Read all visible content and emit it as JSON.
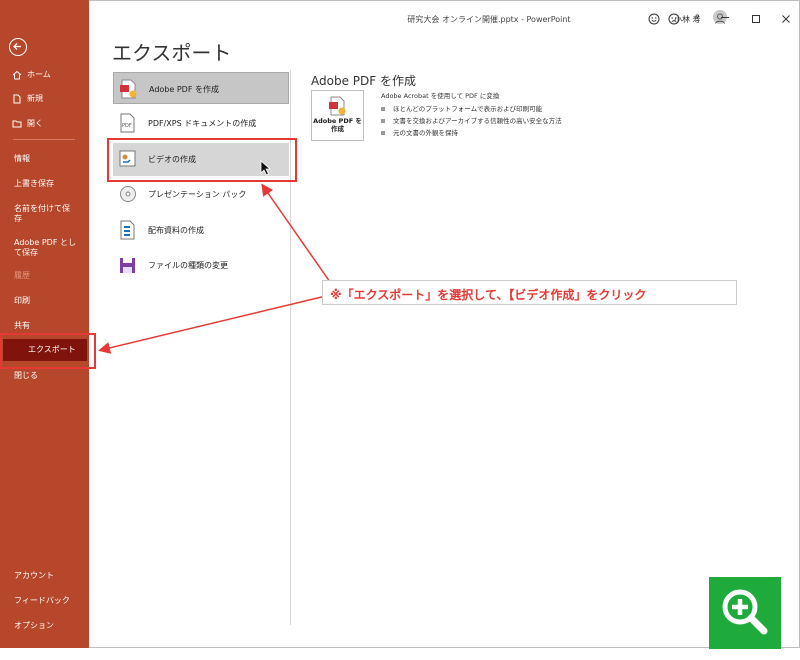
{
  "window": {
    "title": "研究大会 オンライン開催.pptx - PowerPoint",
    "user_name": "小林 寿",
    "help_label": "?"
  },
  "sidebar": {
    "top_items": [
      {
        "label": "ホーム",
        "icon": "home-icon"
      },
      {
        "label": "新規",
        "icon": "new-document-icon"
      },
      {
        "label": "開く",
        "icon": "open-folder-icon"
      }
    ],
    "items": [
      {
        "label": "情報"
      },
      {
        "label": "上書き保存"
      },
      {
        "label": "名前を付けて保存"
      },
      {
        "label": "Adobe PDF として保存"
      },
      {
        "label": "履歴"
      },
      {
        "label": "印刷"
      },
      {
        "label": "共有"
      },
      {
        "label": "エクスポート"
      },
      {
        "label": "閉じる"
      }
    ],
    "bottom_items": [
      {
        "label": "アカウント"
      },
      {
        "label": "フィードバック"
      },
      {
        "label": "オプション"
      }
    ],
    "selected": "エクスポート"
  },
  "page_title": "エクスポート",
  "export_options": [
    {
      "label": "Adobe PDF を作成",
      "icon": "adobe-pdf-icon"
    },
    {
      "label": "PDF/XPS ドキュメントの作成",
      "icon": "pdf-xps-icon"
    },
    {
      "label": "ビデオの作成",
      "icon": "video-icon"
    },
    {
      "label": "プレゼンテーション パック",
      "icon": "cd-package-icon"
    },
    {
      "label": "配布資料の作成",
      "icon": "handout-icon"
    },
    {
      "label": "ファイルの種類の変更",
      "icon": "save-as-type-icon"
    }
  ],
  "panel": {
    "title": "Adobe PDF を作成",
    "button_label": "Adobe PDF を作成",
    "description": "Adobe Acrobat を使用して PDF に変換",
    "bullets": [
      "ほとんどのプラットフォームで表示および印刷可能",
      "文書を交換およびアーカイブする信頼性の高い安全な方法",
      "元の文書の外観を保持"
    ]
  },
  "annotation": {
    "callout": "※「エクスポート」を選択して、【ビデオ作成」をクリック"
  },
  "colors": {
    "sidebar": "#b7472a",
    "sidebar_selected": "#80130b",
    "annotation_red": "#e53935",
    "zoom_green": "#1fab3b"
  }
}
